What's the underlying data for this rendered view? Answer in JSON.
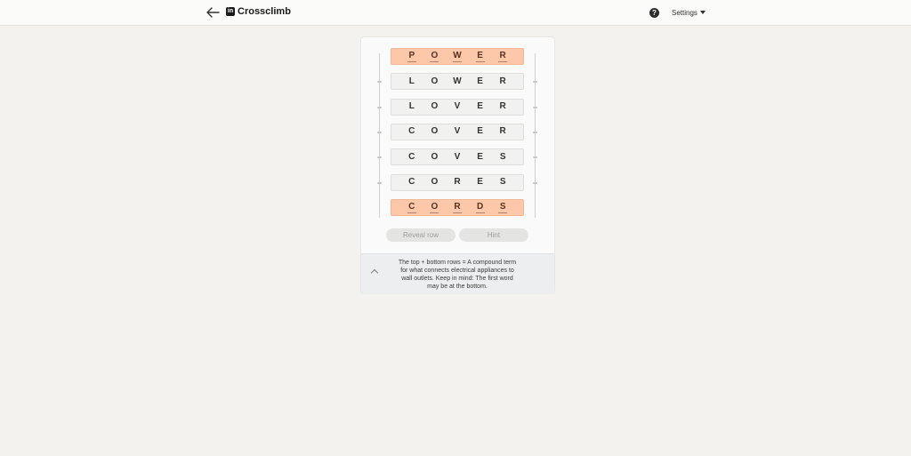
{
  "header": {
    "logo_text": "in",
    "title": "Crossclimb",
    "help_label": "?",
    "settings_label": "Settings"
  },
  "board": {
    "rows": [
      {
        "word": "POWER",
        "locked": true
      },
      {
        "word": "LOWER",
        "locked": false
      },
      {
        "word": "LOVER",
        "locked": false
      },
      {
        "word": "COVER",
        "locked": false
      },
      {
        "word": "COVES",
        "locked": false
      },
      {
        "word": "CORES",
        "locked": false
      },
      {
        "word": "CORDS",
        "locked": true
      }
    ]
  },
  "buttons": {
    "reveal_label": "Reveal row",
    "hint_label": "Hint"
  },
  "clue": {
    "text": "The top + bottom rows = A compound term for what connects electrical appliances to wall outlets. Keep in mind: The first word may be at the bottom."
  },
  "colors": {
    "locked_row": "#fcc8a9",
    "row": "#f1f1f0",
    "background": "#f3f2ef"
  }
}
